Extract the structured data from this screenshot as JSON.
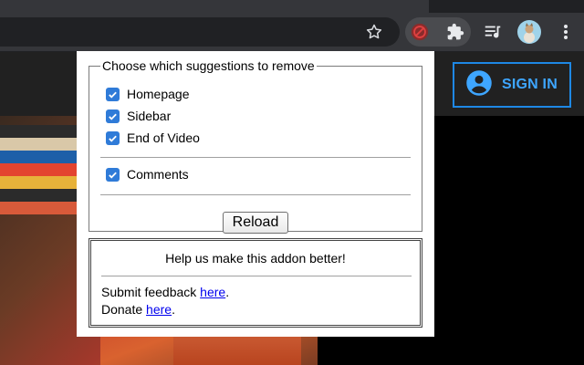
{
  "popup": {
    "legend": "Choose which suggestions to remove",
    "options": [
      {
        "label": "Homepage",
        "checked": true
      },
      {
        "label": "Sidebar",
        "checked": true
      },
      {
        "label": "End of Video",
        "checked": true
      },
      {
        "label": "Comments",
        "checked": true
      }
    ],
    "reload_label": "Reload"
  },
  "feedback": {
    "title": "Help us make this addon better!",
    "submit_prefix": "Submit feedback ",
    "submit_link": "here",
    "submit_suffix": ".",
    "donate_prefix": "Donate ",
    "donate_link": "here",
    "donate_suffix": "."
  },
  "page": {
    "signin_label": "SIGN IN"
  },
  "colors": {
    "checkbox": "#2f7bd8",
    "signin_accent": "#3ea6ff",
    "link": "#0000ee"
  },
  "icons": [
    "star-icon",
    "block-extension-icon",
    "puzzle-extensions-icon",
    "media-queue-icon",
    "profile-avatar",
    "kebab-menu-icon",
    "account-circle-icon"
  ]
}
